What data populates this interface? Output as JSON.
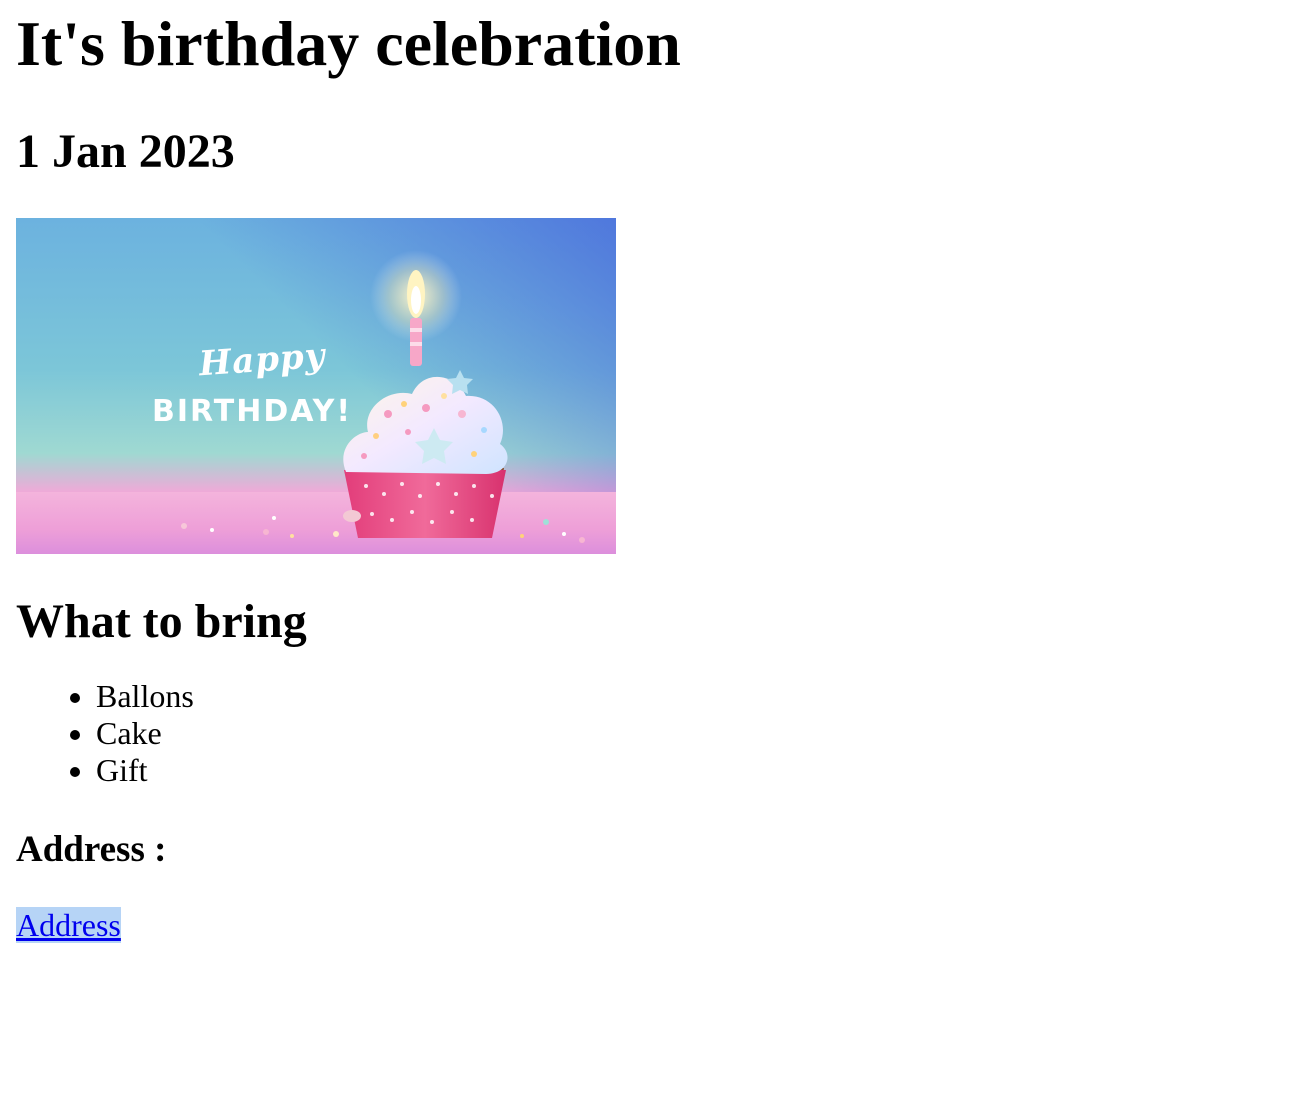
{
  "page": {
    "title": "It's birthday celebration",
    "date": "1 Jan 2023",
    "banner": {
      "script_text": "Happy",
      "headline_text": "BIRTHDAY!"
    },
    "bring_heading": "What to bring",
    "bring_items": [
      "Ballons",
      "Cake",
      "Gift"
    ],
    "address_heading": "Address :",
    "address_link": "Address"
  }
}
